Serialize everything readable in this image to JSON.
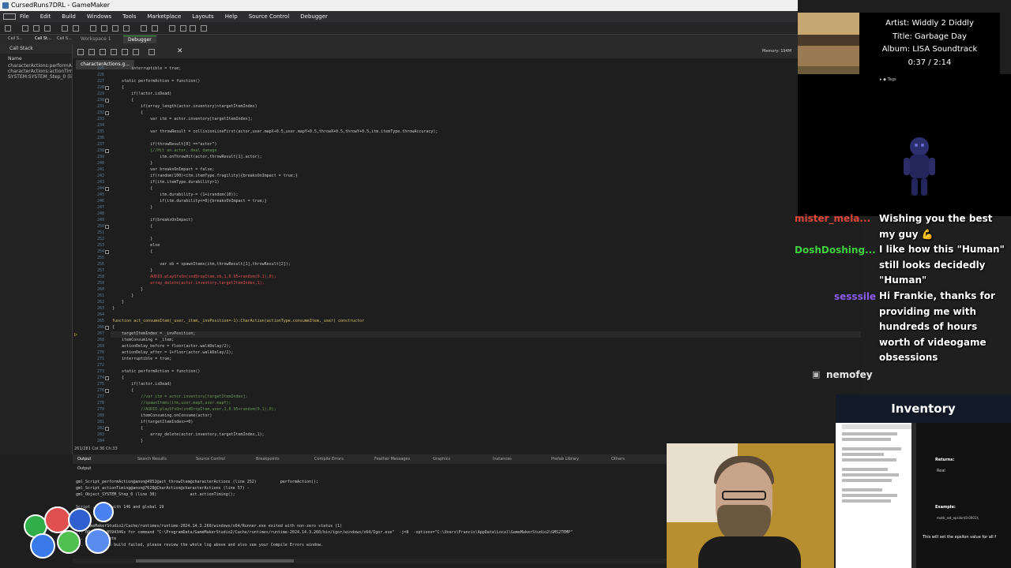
{
  "window": {
    "title": "CursedRuns7DRL - GameMaker"
  },
  "menu": [
    "File",
    "Edit",
    "Build",
    "Windows",
    "Tools",
    "Marketplace",
    "Layouts",
    "Help",
    "Source Control",
    "Debugger"
  ],
  "workspace_tabs": [
    {
      "label": "Workspace 1",
      "active": false
    },
    {
      "label": "Debugger",
      "active": true
    }
  ],
  "left_panel": {
    "tabs": [
      "Call S...",
      "Call St...",
      "Call S..."
    ],
    "title": "Call Stack",
    "column": "Name",
    "rows": [
      "characterActions:performAc",
      "characterActions:actionTim",
      "SYSTEM:SYSTEM_Step_0 (line"
    ]
  },
  "editor": {
    "file_tab": "characterActions.g...",
    "lines": [
      {
        "n": "225",
        "t": "        interruptible = true;"
      },
      {
        "n": "226",
        "t": ""
      },
      {
        "n": "227",
        "t": "    static performAction = function()"
      },
      {
        "n": "228",
        "t": "    {"
      },
      {
        "n": "229",
        "t": "        if(!actor.isDead)"
      },
      {
        "n": "230",
        "t": "        {"
      },
      {
        "n": "231",
        "t": "            if(array_length(actor.inventory)>targetItemIndex)"
      },
      {
        "n": "232",
        "t": "            {"
      },
      {
        "n": "233",
        "t": "                var itm = actor.inventory[targetItemIndex];"
      },
      {
        "n": "234",
        "t": ""
      },
      {
        "n": "235",
        "t": "                var throwResult = collisionLineFirst(actor,user.mapX+0.5,user.mapY+0.5,throwX+0.5,throwY+0.5,itm.itemType.throwAccuracy);"
      },
      {
        "n": "236",
        "t": ""
      },
      {
        "n": "237",
        "t": "                if(throwResult[0] ==\"actor\")"
      },
      {
        "n": "238",
        "t": "                {//Hit an actor, deal damage"
      },
      {
        "n": "239",
        "t": "                    itm.onThrowHit(actor,throwResult[1].actor);"
      },
      {
        "n": "240",
        "t": "                }"
      },
      {
        "n": "241",
        "t": "                var breaksOnImpact = false;"
      },
      {
        "n": "242",
        "t": "                if(random(100)<itm.itemType.fragility){breaksOnImpact = true;}"
      },
      {
        "n": "243",
        "t": "                if(itm.itemType.durability>1)"
      },
      {
        "n": "244",
        "t": "                {"
      },
      {
        "n": "245",
        "t": "                    itm.durability-= (1+irandom(10));"
      },
      {
        "n": "246",
        "t": "                    if(itm.durability<=0){breaksOnImpact = true;}"
      },
      {
        "n": "247",
        "t": "                }"
      },
      {
        "n": "248",
        "t": ""
      },
      {
        "n": "249",
        "t": "                if(breaksOnImpact)"
      },
      {
        "n": "250",
        "t": "                {"
      },
      {
        "n": "251",
        "t": ""
      },
      {
        "n": "252",
        "t": "                }"
      },
      {
        "n": "253",
        "t": "                else"
      },
      {
        "n": "254",
        "t": "                {"
      },
      {
        "n": "255",
        "t": ""
      },
      {
        "n": "256",
        "t": "                    var ob = spawnItems(itm,throwResult[1],throwResult[2]);"
      },
      {
        "n": "257",
        "t": "                }"
      },
      {
        "n": "258",
        "t": "                AUDIO.playSfxOn(sndDropItem,ob,1,0.95+random(0.1),0);"
      },
      {
        "n": "259",
        "t": "                array_delete(actor.inventory,targetItemIndex,1);"
      },
      {
        "n": "260",
        "t": "            }"
      },
      {
        "n": "261",
        "t": "        }"
      },
      {
        "n": "262",
        "t": "    }"
      },
      {
        "n": "263",
        "t": "}"
      },
      {
        "n": "264",
        "t": ""
      },
      {
        "n": "265",
        "t": "function act_consumeItem(_user,_item,_invPosition=-1):CharAction(actionType.consumeItem,_user) constructor"
      },
      {
        "n": "266",
        "t": "{"
      },
      {
        "n": "267",
        "t": "    targetItemIndex = _invPosition;"
      },
      {
        "n": "268",
        "t": "    itemConsuming = _item;"
      },
      {
        "n": "269",
        "t": "    actionDelay_before = floor(actor.walkDelay/2);"
      },
      {
        "n": "270",
        "t": "    actionDelay_after = 1+floor(actor.walkDelay/2);"
      },
      {
        "n": "271",
        "t": "    interruptible = true;"
      },
      {
        "n": "272",
        "t": ""
      },
      {
        "n": "273",
        "t": "    static performAction = function()"
      },
      {
        "n": "274",
        "t": "    {"
      },
      {
        "n": "275",
        "t": "        if(!actor.isDead)"
      },
      {
        "n": "276",
        "t": "        {"
      },
      {
        "n": "277",
        "t": "            //var itm = actor.inventory[targetItemIndex];"
      },
      {
        "n": "278",
        "t": "            //spawnItems(itm,user.mapX,user.mapY);"
      },
      {
        "n": "279",
        "t": "            //AUDIO.playSfxOn(sndDropItem,user,1,0.95+random(0.1),0);"
      },
      {
        "n": "280",
        "t": "            itemConsuming.onConsume(actor)"
      },
      {
        "n": "281",
        "t": "            if(targetItemIndex>=0)"
      },
      {
        "n": "282",
        "t": "            {"
      },
      {
        "n": "283",
        "t": "                array_delete(actor.inventory,targetItemIndex,1);"
      },
      {
        "n": "284",
        "t": "            }"
      }
    ],
    "status": "261/281 Col:36 Ch:33"
  },
  "memory": "Memory: 194M",
  "output_tabs": [
    "Output",
    "Search Results",
    "Source Control",
    "Breakpoints",
    "Compile Errors",
    "Feather Messages",
    "Graphics",
    "Instances",
    "Prefab Library",
    "Others"
  ],
  "output": {
    "title": "Output",
    "lines": [
      "gml_Script_performAction@anon@4952@act_throwItem@characterActions (line 252)          performAction();",
      "gml_Script_actionTiming@anon@7628@CharAction@characterActions (line 57) -",
      "gml_Object_SYSTEM_Step_0 (line 38)              act.actionTiming();",
      "",
      "Script ...  ed with 146 and global 19",
      "",
      "",
      "... GameMakerStudio2/Cache/runtimes/runtime-2024.14.3.260/windows/x64/Runner.exe exited with non-zero status (1)",
      "... 00:48:43.8594346s for command \"C:\\ProgramData/GameMakerStudio2/Cache/runtimes/runtime-2024.14.3.260/bin/igor/windows/x64/Igor.exe\"  -j=8  -options=\"C:\\Users\\Francis\\AppData\\Local\\GameMakerStudio2\\GMS2TEMP\"",
      "... gram Complete",
      "... of why this build failed, please review the whole log above and also see your Compile Errors window."
    ]
  },
  "now_playing": {
    "artist": "Artist: Widdly 2 Diddly",
    "title": "Title: Garbage Day",
    "album": "Album: LISA Soundtrack",
    "time": "0:37 / 2:14"
  },
  "tags_label": "Tags",
  "chat": [
    {
      "user": "mister_mela...",
      "color": "#e0453a",
      "message": "Wishing you the best my guy 💪"
    },
    {
      "user": "DoshDoshing...",
      "color": "#3fd13f",
      "message": "I like how this \"Human\" still looks decidedly \"Human\""
    },
    {
      "user": "sesssile",
      "color": "#8a5cf0",
      "message": "Hi Frankie, thanks for providing me with hundreds of hours worth of videogame obsessions"
    },
    {
      "user": "nemofey",
      "color": "#e8e8e8",
      "message": ""
    }
  ],
  "inventory_banner": "Inventory",
  "docs": {
    "returns": "Returns:",
    "returns_value": "Real",
    "example": "Example:",
    "example_code": "math_set_epsilon(0.0001);",
    "footer": "This will set the epsilon value for all f"
  },
  "colors": {
    "accent": "#40a040",
    "editor_bg": "#1e1e1e",
    "panel_bg": "#252526"
  }
}
